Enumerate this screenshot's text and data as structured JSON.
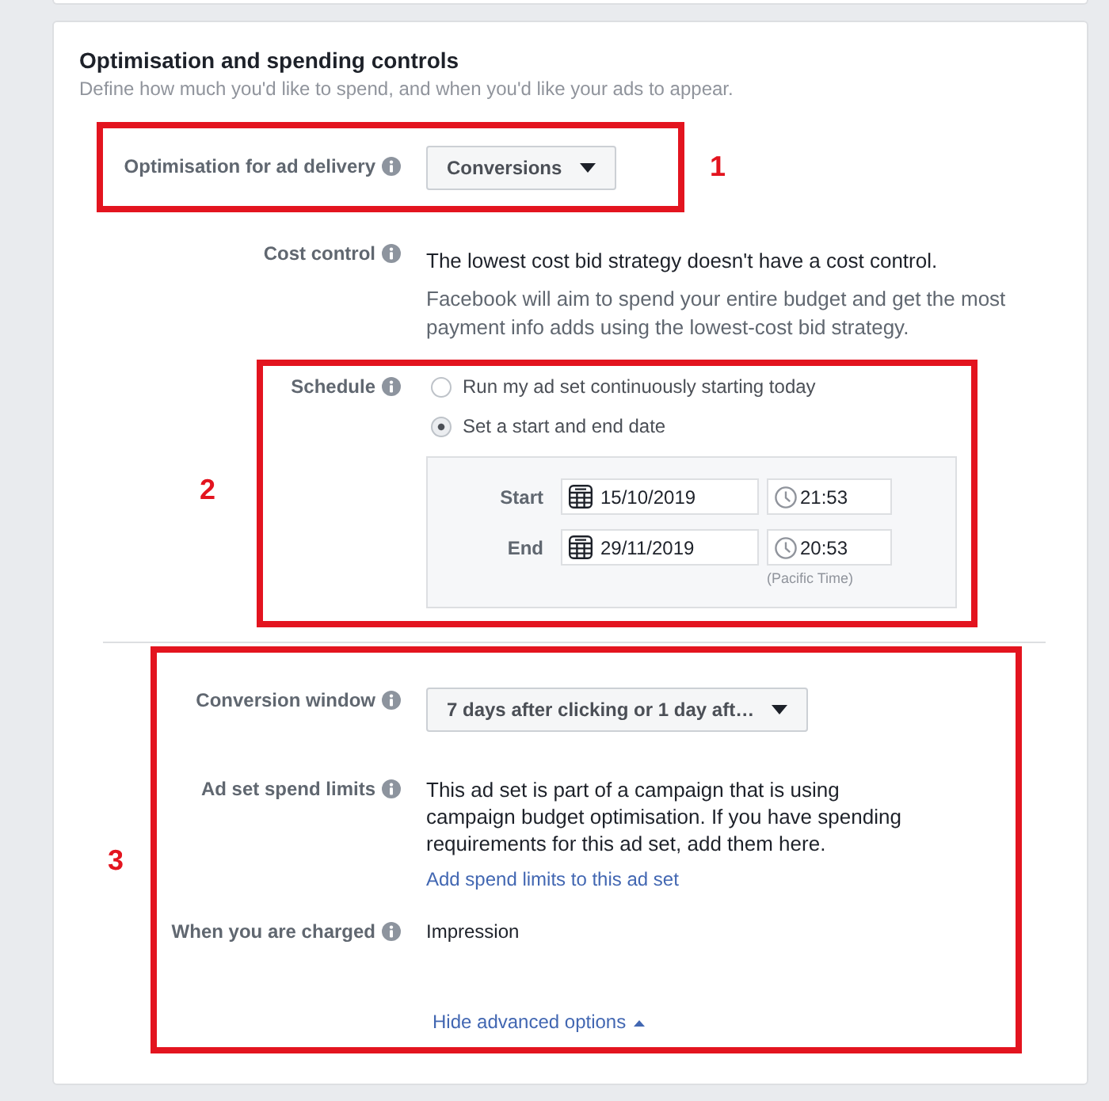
{
  "section": {
    "title": "Optimisation and spending controls",
    "subtitle": "Define how much you'd like to spend, and when you'd like your ads to appear."
  },
  "fields": [
    {
      "kind": "dropdown",
      "label": "Optimisation for ad delivery",
      "value": "Conversions"
    },
    {
      "kind": "text",
      "label": "Cost control",
      "text": "The lowest cost bid strategy doesn't have a cost control.",
      "note": "Facebook will aim to spend your entire budget and get the most payment info adds using the lowest-cost bid strategy."
    },
    {
      "kind": "schedule",
      "label": "Schedule",
      "options": [
        {
          "label": "Run my ad set continuously starting today",
          "selected": false
        },
        {
          "label": "Set a start and end date",
          "selected": true
        }
      ],
      "dates": [
        {
          "label": "Start",
          "date": "15/10/2019",
          "time": "21:53"
        },
        {
          "label": "End",
          "date": "29/11/2019",
          "time": "20:53"
        }
      ],
      "timezone": "(Pacific Time)"
    }
  ],
  "advanced": {
    "expanded": true,
    "fields": [
      {
        "kind": "dropdown",
        "label": "Conversion window",
        "value": "7 days after clicking or 1 day aft…"
      },
      {
        "kind": "text",
        "label": "Ad set spend limits",
        "text": "This ad set is part of a campaign that is using campaign budget optimisation. If you have spending requirements for this ad set, add them here.",
        "link": "Add spend limits to this ad set"
      },
      {
        "kind": "value",
        "label": "When you are charged",
        "text": "Impression"
      }
    ],
    "toggle": "Hide advanced options"
  },
  "annotations": [
    {
      "label": "1"
    },
    {
      "label": "2"
    },
    {
      "label": "3"
    }
  ]
}
